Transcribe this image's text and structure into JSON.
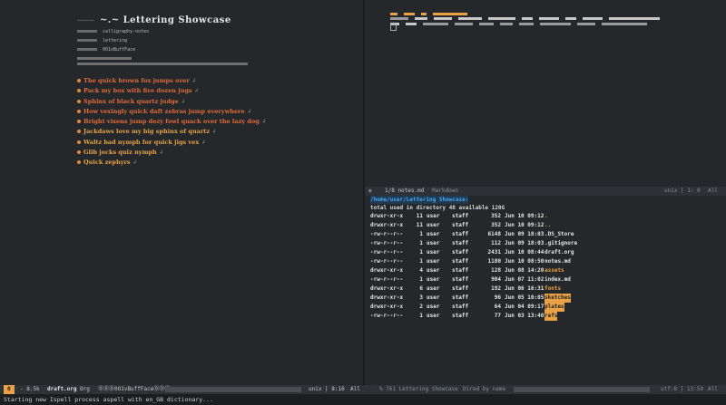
{
  "org": {
    "title": "~.~ Lettering Showcase",
    "meta": [
      {
        "value": "calligraphy-notes"
      },
      {
        "value": "lettering"
      },
      {
        "value": "0O1vBuffFace"
      }
    ],
    "items": [
      {
        "text": "The quick brown fox jumps over",
        "color": "red"
      },
      {
        "text": "Pack my box with five dozen jugs",
        "color": "red"
      },
      {
        "text": "Sphinx of black quartz judge",
        "color": "red"
      },
      {
        "text": "How vexingly quick daft zebras jump everywhere",
        "color": "red"
      },
      {
        "text": "Bright vixens jump dozy fowl quack over the lazy dog",
        "color": "red"
      },
      {
        "text": "Jackdaws love my big sphinx of quartz",
        "color": "orange"
      },
      {
        "text": "Waltz bad nymph for quick jigs vex",
        "color": "orange"
      },
      {
        "text": "Glib jocks quiz nymph",
        "color": "orange"
      },
      {
        "text": "Quick zephyrs",
        "color": "orange"
      }
    ]
  },
  "mode_mid": {
    "left": "1/8  notes.md",
    "mode": "Markdown",
    "encoding": "unix | 1: 0",
    "pos": "All"
  },
  "dired": {
    "path": "/home/user/Lettering Showcase:",
    "total": "total used in directory 48 available 120G",
    "rows": [
      {
        "perm": "drwxr-xr-x",
        "n": "11",
        "user": "user",
        "group": "staff",
        "size": "352",
        "date": "Jun 10 09:12",
        "name": ".",
        "style": "dir"
      },
      {
        "perm": "drwxr-xr-x",
        "n": "11",
        "user": "user",
        "group": "staff",
        "size": "352",
        "date": "Jun 10 09:12",
        "name": "..",
        "style": "dir"
      },
      {
        "perm": "-rw-r--r--",
        "n": "1",
        "user": "user",
        "group": "staff",
        "size": "6148",
        "date": "Jun 09 18:03",
        "name": ".DS_Store",
        "style": "file"
      },
      {
        "perm": "-rw-r--r--",
        "n": "1",
        "user": "user",
        "group": "staff",
        "size": "112",
        "date": "Jun 09 18:03",
        "name": ".gitignore",
        "style": "file"
      },
      {
        "perm": "-rw-r--r--",
        "n": "1",
        "user": "user",
        "group": "staff",
        "size": "2431",
        "date": "Jun 10 08:44",
        "name": "draft.org",
        "style": "file"
      },
      {
        "perm": "-rw-r--r--",
        "n": "1",
        "user": "user",
        "group": "staff",
        "size": "1180",
        "date": "Jun 10 08:50",
        "name": "notes.md",
        "style": "file"
      },
      {
        "perm": "drwxr-xr-x",
        "n": "4",
        "user": "user",
        "group": "staff",
        "size": "128",
        "date": "Jun 08 14:20",
        "name": "assets",
        "style": "dir"
      },
      {
        "perm": "-rw-r--r--",
        "n": "1",
        "user": "user",
        "group": "staff",
        "size": "904",
        "date": "Jun 07 11:02",
        "name": "index.md",
        "style": "file"
      },
      {
        "perm": "drwxr-xr-x",
        "n": "6",
        "user": "user",
        "group": "staff",
        "size": "192",
        "date": "Jun 06 16:31",
        "name": "fonts",
        "style": "dir"
      },
      {
        "perm": "drwxr-xr-x",
        "n": "3",
        "user": "user",
        "group": "staff",
        "size": "96",
        "date": "Jun 05 10:05",
        "name": "sketches",
        "style": "hl"
      },
      {
        "perm": "drwxr-xr-x",
        "n": "2",
        "user": "user",
        "group": "staff",
        "size": "64",
        "date": "Jun 04 09:17",
        "name": "plates",
        "style": "hl"
      },
      {
        "perm": "-rw-r--r--",
        "n": "1",
        "user": "user",
        "group": "staff",
        "size": "77",
        "date": "Jun 03 13:40",
        "name": "refs",
        "style": "hl"
      }
    ]
  },
  "modeline_bottom": {
    "badge": "0",
    "size": "- 8.5k",
    "buffer": "draft.org",
    "mode": "Org",
    "minor": "⓪⓪⓪0O1vBuffFace⓪⓪⓪",
    "encoding": "unix | 8:16",
    "pos": "All",
    "right_buffer": "% 761  Lettering Showcase",
    "right_mode": "Dired by name",
    "right_enc": "utf-8 | 13:59",
    "right_pos": "All"
  },
  "echo": "Starting new Ispell process aspell with en_GB dictionary..."
}
